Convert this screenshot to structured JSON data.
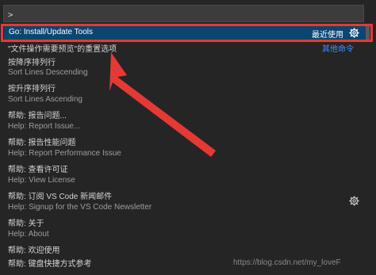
{
  "input": {
    "value": ">",
    "placeholder": ""
  },
  "selected": {
    "label": "Go: Install/Update Tools",
    "badge": "最近使用"
  },
  "other_commands": "其他命令",
  "items": [
    {
      "primary": "\"文件操作需要预览\"的重置选项",
      "secondary": ""
    },
    {
      "primary": "按降序排列行",
      "secondary": "Sort Lines Descending"
    },
    {
      "primary": "按升序排列行",
      "secondary": "Sort Lines Ascending"
    },
    {
      "primary": "帮助: 报告问题...",
      "secondary": "Help: Report Issue..."
    },
    {
      "primary": "帮助: 报告性能问题",
      "secondary": "Help: Report Performance Issue"
    },
    {
      "primary": "帮助: 查看许可证",
      "secondary": "Help: View License"
    },
    {
      "primary": "帮助: 订阅 VS Code 新闻邮件",
      "secondary": "Help: Signup for the VS Code Newsletter"
    },
    {
      "primary": "帮助: 关于",
      "secondary": "Help: About"
    },
    {
      "primary": "帮助: 欢迎使用",
      "secondary": ""
    },
    {
      "primary": "帮助: 键盘快捷方式参考",
      "secondary": ""
    }
  ],
  "watermark": "https://blog.csdn.net/my_loveF",
  "colors": {
    "selection": "#094771",
    "highlight_box": "#e53935",
    "link": "#3794ff"
  },
  "icons": [
    "gear-icon"
  ]
}
